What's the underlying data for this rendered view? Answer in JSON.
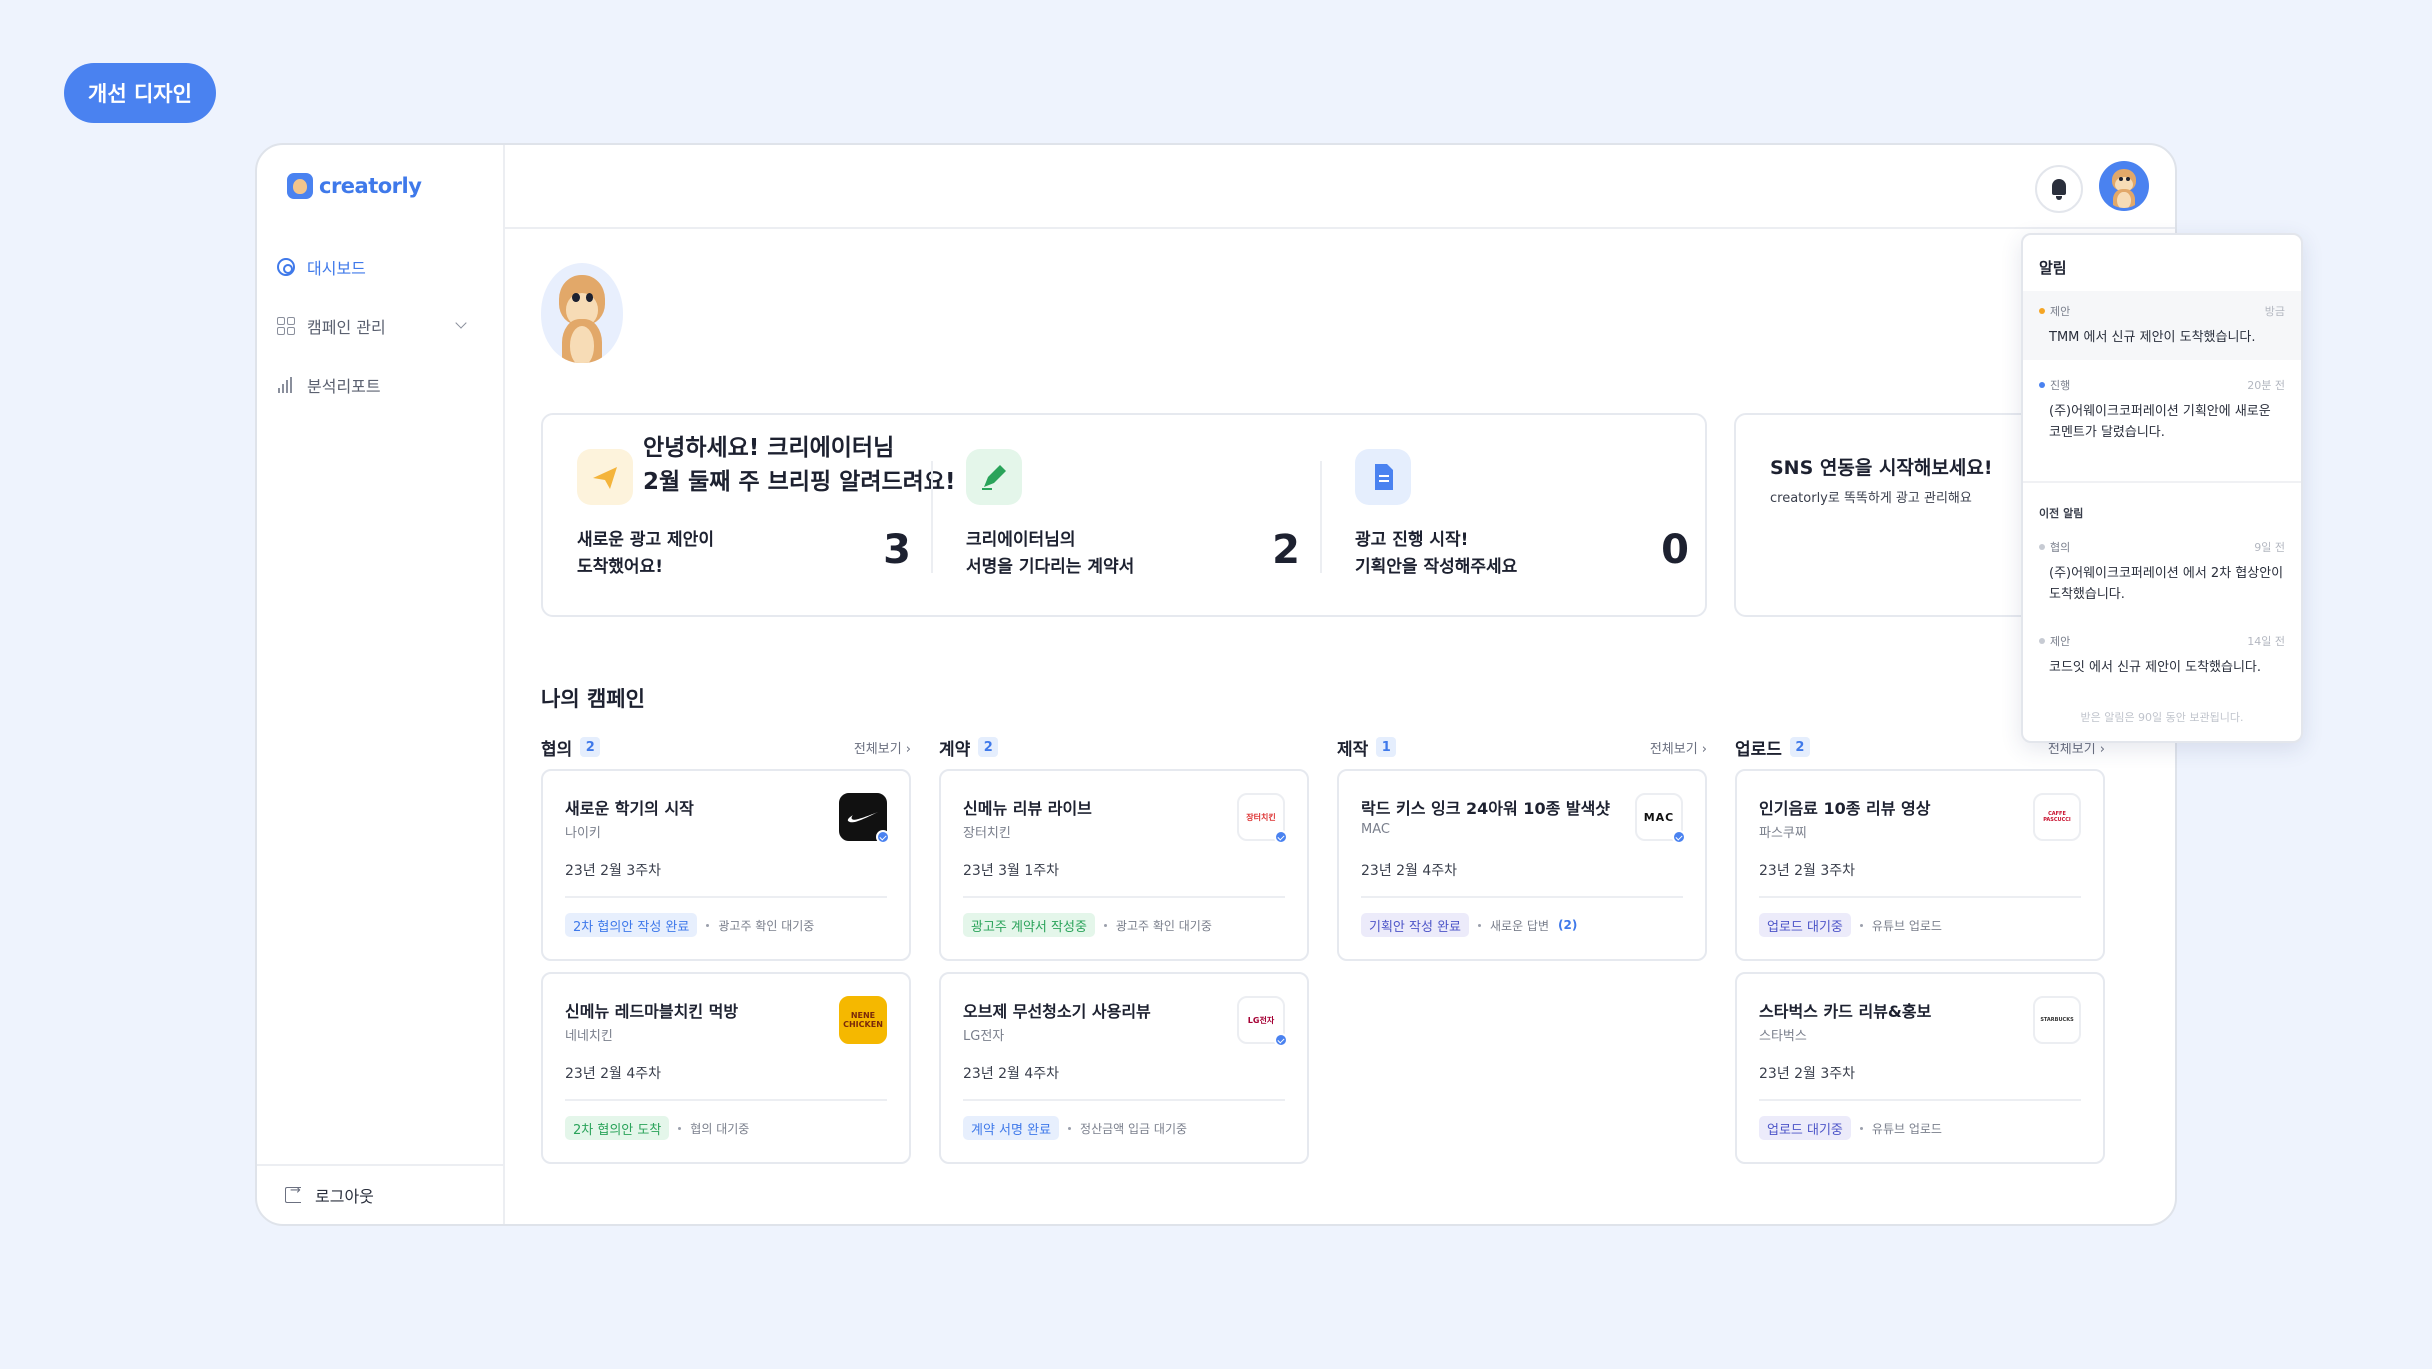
{
  "badge": "개선 디자인",
  "sidebar": {
    "logo": "creatorly",
    "items": [
      {
        "label": "대시보드"
      },
      {
        "label": "캠페인 관리"
      },
      {
        "label": "분석리포트"
      }
    ],
    "logout": "로그아웃"
  },
  "greeting": {
    "line1": "안녕하세요! 크리에이터님",
    "line2": "2월 둘째 주 브리핑 알려드려요!"
  },
  "stats": [
    {
      "line1": "새로운 광고 제안이",
      "line2": "도착했어요!",
      "count": "3"
    },
    {
      "line1": "크리에이터님의",
      "line2": "서명을 기다리는 계약서",
      "count": "2"
    },
    {
      "line1": "광고 진행 시작!",
      "line2": "기획안을 작성해주세요",
      "count": "0"
    }
  ],
  "sns": {
    "title": "SNS 연동을 시작해보세요!",
    "subtitle": "creatorly로 똑똑하게 광고 관리해요"
  },
  "campaigns": {
    "title": "나의 캠페인",
    "see_all": "전체보기 ›",
    "columns": [
      {
        "name": "협의",
        "count": "2",
        "cards": [
          {
            "title": "새로운 학기의 시작",
            "brand": "나이키",
            "date": "23년 2월 3주차",
            "tag": "2차 협의안 작성 완료",
            "status": "광고주 확인 대기중"
          },
          {
            "title": "신메뉴 레드마블치킨 먹방",
            "brand": "네네치킨",
            "date": "23년 2월 4주차",
            "tag": "2차 협의안 도착",
            "status": "협의 대기중"
          }
        ]
      },
      {
        "name": "계약",
        "count": "2",
        "cards": [
          {
            "title": "신메뉴 리뷰 라이브",
            "brand": "장터치킨",
            "date": "23년 3월 1주차",
            "tag": "광고주 계약서 작성중",
            "status": "광고주 확인 대기중"
          },
          {
            "title": "오브제 무선청소기 사용리뷰",
            "brand": "LG전자",
            "date": "23년 2월 4주차",
            "tag": "계약 서명 완료",
            "status": "정산금액 입금 대기중"
          }
        ]
      },
      {
        "name": "제작",
        "count": "1",
        "cards": [
          {
            "title": "락드 키스 잉크 24아워 10종 발색샷",
            "brand": "MAC",
            "date": "23년 2월 4주차",
            "tag": "기획안 작성 완료",
            "status": "새로운 답변",
            "status_count": "(2)"
          }
        ]
      },
      {
        "name": "업로드",
        "count": "2",
        "cards": [
          {
            "title": "인기음료 10종 리뷰 영상",
            "brand": "파스쿠찌",
            "date": "23년 2월 3주차",
            "tag": "업로드 대기중",
            "status": "유튜브 업로드"
          },
          {
            "title": "스타벅스 카드 리뷰&홍보",
            "brand": "스타벅스",
            "date": "23년 2월 3주차",
            "tag": "업로드 대기중",
            "status": "유튜브 업로드"
          }
        ]
      }
    ]
  },
  "brand_logos": {
    "jangter": "장터치킨",
    "nene": "NENE CHICKEN",
    "lg": "LG전자",
    "mac": "MAC",
    "pascucci": "CAFFE PASCUCCI",
    "starbucks": "STARBUCKS"
  },
  "notifications": {
    "title": "알림",
    "items": [
      {
        "type": "제안",
        "time": "방금",
        "text": "TMM 에서 신규 제안이 도착했습니다.",
        "color": "#f5a524"
      },
      {
        "type": "진행",
        "time": "20분 전",
        "text": "(주)어웨이크코퍼레이션 기획안에 새로운 코멘트가 달렸습니다.",
        "color": "#4a82f0"
      }
    ],
    "previous_title": "이전 알림",
    "previous": [
      {
        "type": "협의",
        "time": "9일 전",
        "text": "(주)어웨이크코퍼레이션 에서 2차 협상안이 도착했습니다.",
        "color": "#c7cbd3"
      },
      {
        "type": "제안",
        "time": "14일 전",
        "text": "코드잇 에서 신규 제안이 도착했습니다.",
        "color": "#c7cbd3"
      }
    ],
    "footer": "받은 알림은 90일 동안 보관됩니다."
  },
  "colors": {
    "accent": "#4a82f0",
    "background": "#eef3fd"
  }
}
